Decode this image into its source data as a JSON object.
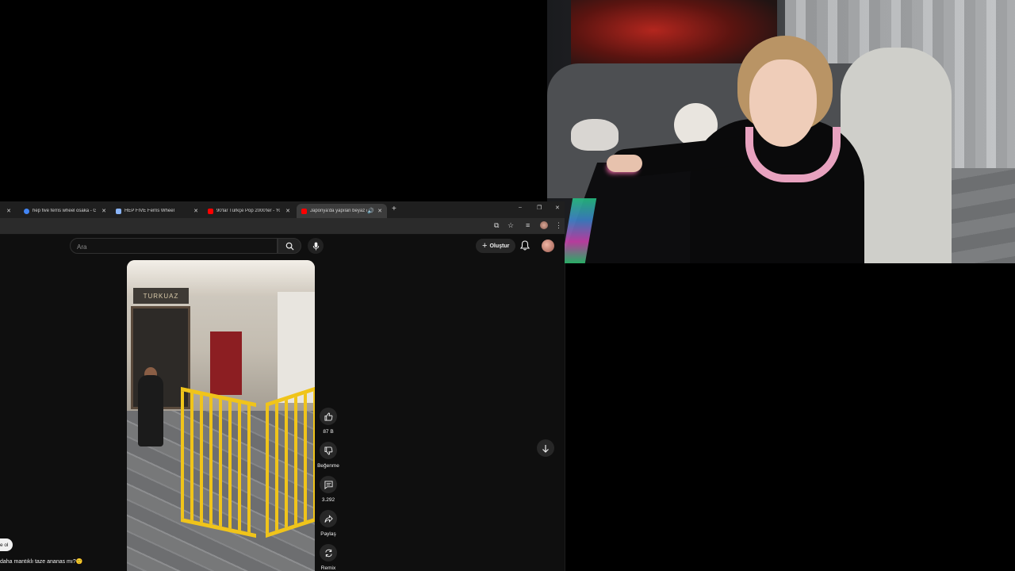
{
  "browser": {
    "tabs": [
      {
        "title": "hep five ferris wheel osaka - G",
        "icon": "google-icon",
        "color": "#4285f4"
      },
      {
        "title": "HEP FIVE Ferris Wheel",
        "icon": "perplexity-icon",
        "color": "#8ab4f8"
      },
      {
        "title": "90'lar Türkçe Pop 2000'ler - You",
        "icon": "youtube-icon",
        "color": "#ff0000"
      },
      {
        "title": "Japonya'da yapılan beyaz ç",
        "icon": "youtube-icon",
        "color": "#ff0000",
        "active": true
      }
    ],
    "new_tab": "+",
    "window_controls": {
      "minimize": "–",
      "restore": "❐",
      "close": "✕"
    }
  },
  "youtube": {
    "search_placeholder": "Ara",
    "create_label": "Oluştur",
    "accent": "#ff0000"
  },
  "video": {
    "sign_text": "TURKUAZ",
    "actions": [
      {
        "name": "like",
        "label": "87 B"
      },
      {
        "name": "dislike",
        "label": "Beğenme"
      },
      {
        "name": "comments",
        "label": "3.292"
      },
      {
        "name": "share",
        "label": "Paylaş"
      },
      {
        "name": "remix",
        "label": "Remix"
      }
    ]
  },
  "comment": {
    "chip": "e ol",
    "text": "daha mantıklı taze ananas mı?🙂"
  }
}
